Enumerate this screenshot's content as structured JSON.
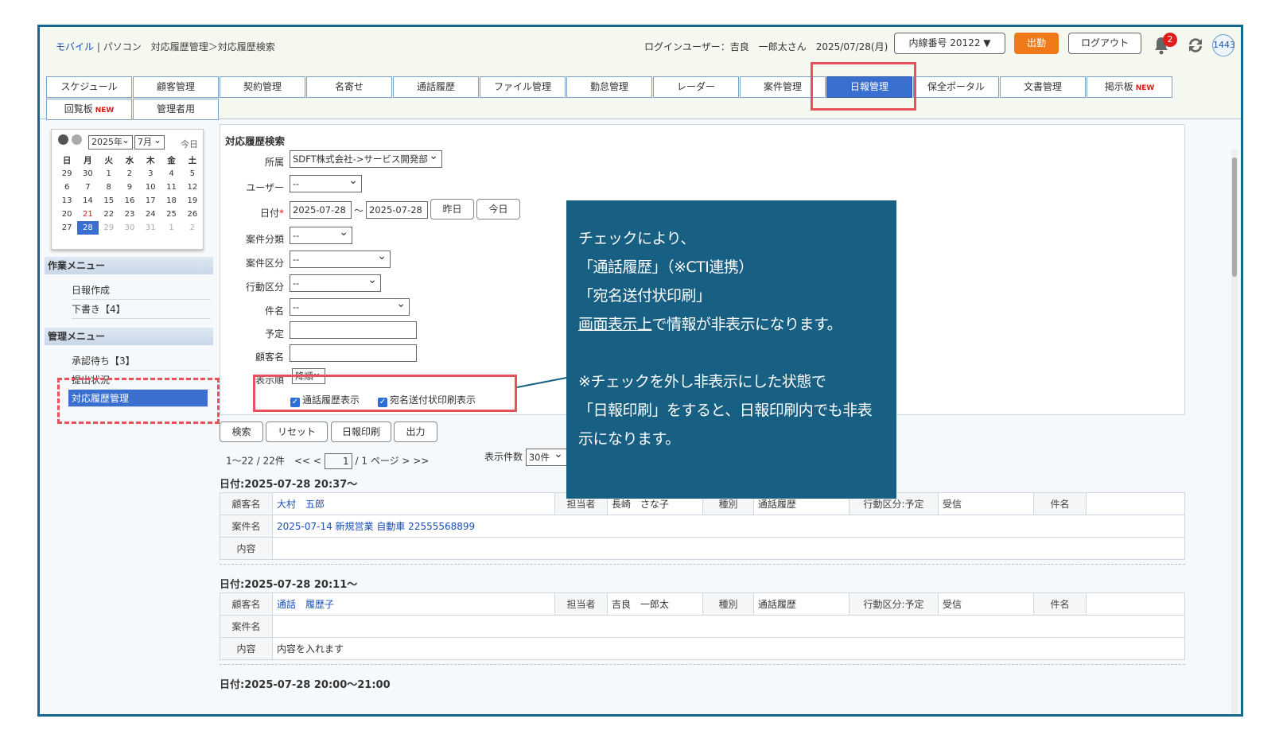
{
  "header": {
    "breadcrumb_mobile": "モバイル",
    "breadcrumb_sep": " | ",
    "breadcrumb_pc": "パソコン",
    "breadcrumb_path": "対応履歴管理＞対応履歴検索",
    "login_user": "ログインユーザー：吉良　一郎太さん　2025/07/28(月)",
    "extension": "内線番号  20122  ▼",
    "clock_out": "出勤",
    "logout": "ログアウト",
    "notification_count": "2",
    "user_id": "1443"
  },
  "nav": {
    "tabs": [
      "スケジュール",
      "顧客管理",
      "契約管理",
      "名寄せ",
      "通話履歴",
      "ファイル管理",
      "勤怠管理",
      "レーダー",
      "案件管理",
      "日報管理",
      "保全ポータル",
      "文書管理",
      "掲示板",
      "回覧板",
      "管理者用"
    ],
    "new_label": "NEW"
  },
  "calendar": {
    "year": "2025年",
    "month": "7月",
    "today": "今日",
    "weekdays": [
      "日",
      "月",
      "火",
      "水",
      "木",
      "金",
      "土"
    ],
    "weeks": [
      [
        "29",
        "30",
        "1",
        "2",
        "3",
        "4",
        "5"
      ],
      [
        "6",
        "7",
        "8",
        "9",
        "10",
        "11",
        "12"
      ],
      [
        "13",
        "14",
        "15",
        "16",
        "17",
        "18",
        "19"
      ],
      [
        "20",
        "21",
        "22",
        "23",
        "24",
        "25",
        "26"
      ],
      [
        "27",
        "28",
        "29",
        "30",
        "31",
        "1",
        "2"
      ]
    ]
  },
  "sidebar": {
    "work_menu": "作業メニュー",
    "work_items": [
      "日報作成",
      "下書き【4】"
    ],
    "admin_menu": "管理メニュー",
    "admin_items": [
      "承認待ち【3】",
      "提出状況",
      "対応履歴管理"
    ]
  },
  "form": {
    "title": "対応履歴検索",
    "dept_label": "所属",
    "dept_value": "SDFT株式会社->サービス開発部",
    "user_label": "ユーザー",
    "user_value": "--",
    "date_label": "日付",
    "date_from": "2025-07-28",
    "date_tilde": "～",
    "date_to": "2025-07-28",
    "yesterday": "昨日",
    "today": "今日",
    "case_type_label": "案件分類",
    "case_type_value": "--",
    "case_div_label": "案件区分",
    "case_div_value": "--",
    "action_label": "行動区分",
    "action_value": "--",
    "subject_label": "件名",
    "subject_value": "--",
    "plan_label": "予定",
    "customer_label": "顧客名",
    "order_label": "表示順",
    "order_value": "降順",
    "chk_call": "通話履歴表示",
    "chk_label": "宛名送付状印刷表示"
  },
  "actions": {
    "search": "検索",
    "reset": "リセット",
    "print": "日報印刷",
    "output": "出力"
  },
  "pager": {
    "range": "1～22 / 22件",
    "prev": "<< <",
    "page": "1",
    "total": "/ 1 ページ",
    "next": "> >>",
    "per_label": "表示件数",
    "per_value": "30件"
  },
  "entries": [
    {
      "heading": "日付:2025-07-28 20:37～",
      "customer_label": "顧客名",
      "customer": "大村　五郎",
      "staff_label": "担当者",
      "staff": "長崎　さな子",
      "kind_label": "種別",
      "kind": "通話履歴",
      "action_label": "行動区分:予定",
      "action": "受信",
      "subject_label": "件名",
      "case_label": "案件名",
      "case": "2025-07-14 新規営業 自動車 22555568899",
      "content_label": "内容",
      "content": ""
    },
    {
      "heading": "日付:2025-07-28 20:11～",
      "customer_label": "顧客名",
      "customer": "通話　履歴子",
      "staff_label": "担当者",
      "staff": "吉良　一郎太",
      "kind_label": "種別",
      "kind": "通話履歴",
      "action_label": "行動区分:予定",
      "action": "受信",
      "subject_label": "件名",
      "case_label": "案件名",
      "case": "",
      "content_label": "内容",
      "content": "内容を入れます"
    }
  ],
  "entry3_heading": "日付:2025-07-28 20:00～21:00",
  "callout": {
    "line1": "チェックにより、",
    "line2": "「通話履歴」（※CTI連携）",
    "line3": "「宛名送付状印刷」",
    "line4_u": "画面表示上",
    "line4_rest": "で情報が非表示になります。",
    "line5": "※チェックを外し非表示にした状態で",
    "line6": "「日報印刷」をすると、日報印刷内でも非表",
    "line7": "示になります。"
  },
  "colors": {
    "accent": "#3a6fcf",
    "highlight": "#e8505b",
    "callout_bg": "#175f83",
    "clock_out": "#f07a1a"
  }
}
